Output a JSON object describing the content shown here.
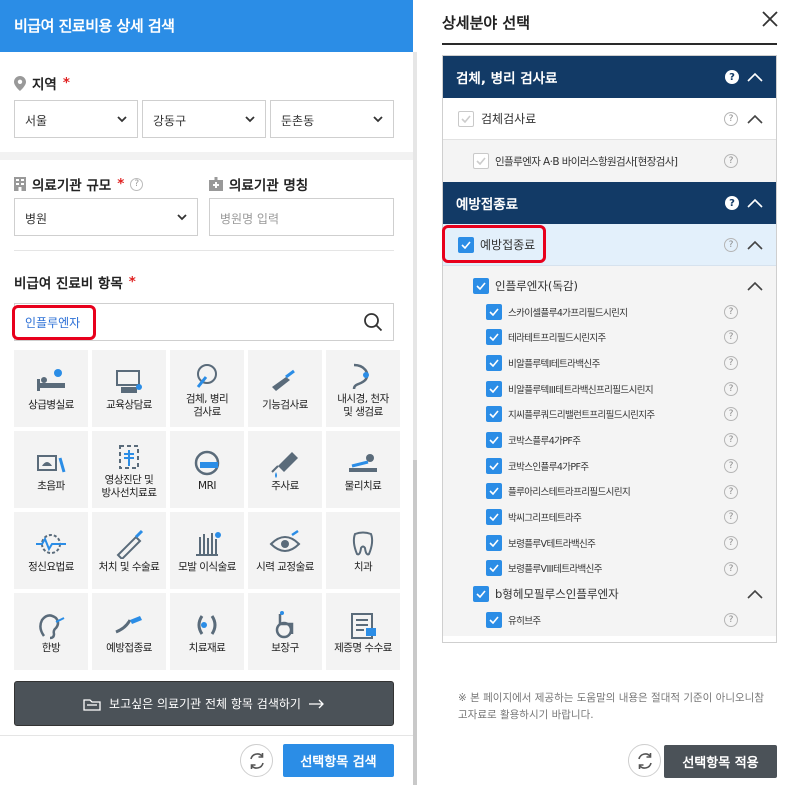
{
  "left": {
    "title": "비급여 진료비용 상세 검색",
    "region": {
      "label": "지역",
      "required": "*",
      "selects": [
        "서울",
        "강동구",
        "둔촌동"
      ]
    },
    "scale": {
      "label": "의료기관 규모",
      "required": "*",
      "value": "병원"
    },
    "name": {
      "label": "의료기관 명칭",
      "placeholder": "병원명 입력"
    },
    "items": {
      "label": "비급여 진료비 항목",
      "required": "*",
      "search_value": "인플루엔자",
      "categories": [
        {
          "label": "상급병실료",
          "icon": "hospital-bed-icon"
        },
        {
          "label": "교육상담료",
          "icon": "consultation-icon"
        },
        {
          "label": "검체, 병리\n검사료",
          "icon": "specimen-test-icon"
        },
        {
          "label": "기능검사료",
          "icon": "function-test-icon"
        },
        {
          "label": "내시경, 천자\n및 생검료",
          "icon": "endoscope-icon"
        },
        {
          "label": "초음파",
          "icon": "ultrasound-icon"
        },
        {
          "label": "영상진단 및\n방사선치료료",
          "icon": "radiology-icon"
        },
        {
          "label": "MRI",
          "icon": "mri-icon"
        },
        {
          "label": "주사료",
          "icon": "syringe-icon"
        },
        {
          "label": "물리치료",
          "icon": "physical-therapy-icon"
        },
        {
          "label": "정신요법료",
          "icon": "psychotherapy-icon"
        },
        {
          "label": "처치 및 수술료",
          "icon": "surgery-icon"
        },
        {
          "label": "모발 이식술료",
          "icon": "hair-transplant-icon"
        },
        {
          "label": "시력 교정술료",
          "icon": "eye-icon"
        },
        {
          "label": "치과",
          "icon": "tooth-icon"
        },
        {
          "label": "한방",
          "icon": "ear-acupuncture-icon"
        },
        {
          "label": "예방접종료",
          "icon": "vaccination-icon"
        },
        {
          "label": "치료재료",
          "icon": "treatment-material-icon"
        },
        {
          "label": "보장구",
          "icon": "wheelchair-icon"
        },
        {
          "label": "제증명 수수료",
          "icon": "certificate-icon"
        }
      ]
    },
    "all_items_button": "보고싶은 의료기관 전체 항목 검색하기",
    "search_button": "선택항목 검색"
  },
  "right": {
    "title": "상세분야 선택",
    "groups": [
      {
        "category": "검체, 병리 검사료",
        "sub": "검체검사료",
        "items": [
          "인플루엔자 A·B 바이러스항원검사[현장검사]"
        ]
      },
      {
        "category": "예방접종료",
        "sub": "예방접종료",
        "subgroups": [
          {
            "label": "인플루엔자(독감)",
            "items": [
              "스카이셀플루4가프리필드시린지",
              "테라테트프리필드시린지주",
              "비알플루텍I테트라백신주",
              "비알플루텍III테트라백신프리필드시린지",
              "지씨플루쿼드리밸런트프리필드시린지주",
              "코박스플루4가PF주",
              "코박스인플루4가PF주",
              "플루아리스테트라프리필드시린지",
              "박씨그리프테트라주",
              "보령플루Ⅴ테트라백신주",
              "보령플루VIII테트라백신주"
            ]
          },
          {
            "label": "b형헤모필루스인플루엔자",
            "items": [
              "유히브주"
            ]
          }
        ]
      }
    ],
    "note": "※ 본 페이지에서 제공하는 도움말의 내용은 절대적 기준이 아니오니참고자료로 활용하시기 바랍니다.",
    "apply_button": "선택항목 적용",
    "help_glyph": "?"
  },
  "colors": {
    "primary": "#2b8de6",
    "navy": "#123a66",
    "highlight": "#e8001c",
    "dark_button": "#4b5258"
  }
}
